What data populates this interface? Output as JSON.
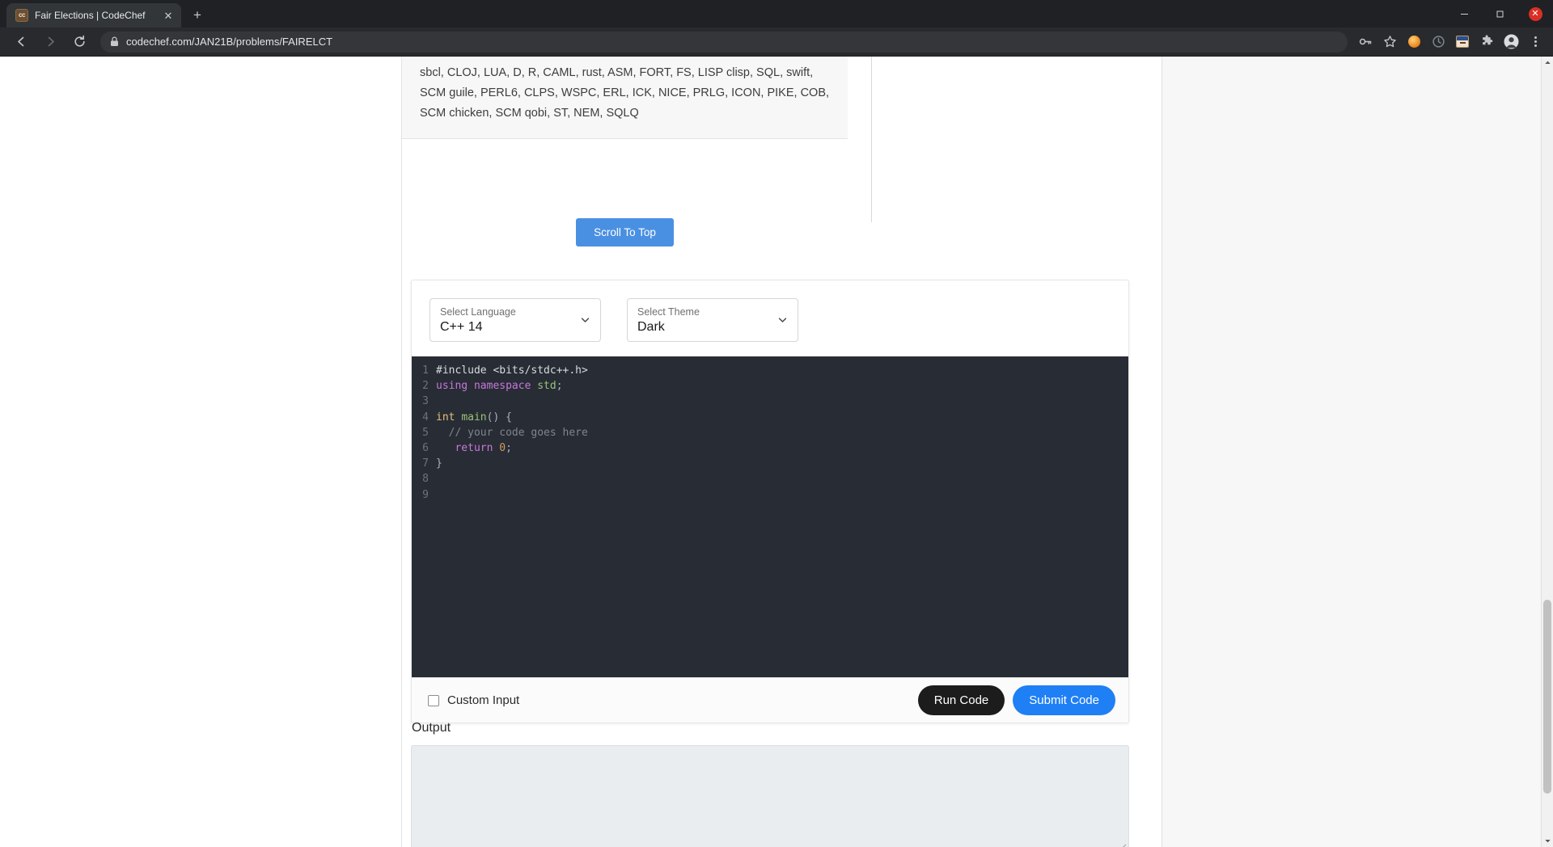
{
  "browser": {
    "tab": {
      "title": "Fair Elections | CodeChef",
      "favicon_text": "cc",
      "favicon_name": "codechef-favicon",
      "close_label": "✕"
    },
    "new_tab_label": "+",
    "window_controls": {
      "minimize": "minimize-icon",
      "maximize": "maximize-icon",
      "close": "✕"
    },
    "toolbar": {
      "back": "back-arrow-icon",
      "forward": "forward-arrow-icon",
      "reload": "reload-icon",
      "url": "codechef.com/JAN21B/problems/FAIRELCT",
      "lock": "lock-icon",
      "icons": [
        "password-key-icon",
        "bookmark-star-icon",
        "extension-orange-icon",
        "extension-clock-icon",
        "extension-avatar-icon",
        "puzzle-extensions-icon",
        "profile-avatar-icon",
        "three-dot-menu-icon"
      ]
    }
  },
  "page": {
    "languages_paragraph": [
      "sbcl, CLOJ, LUA, D, R, CAML, rust, ASM, FORT, FS, LISP",
      "clisp, SQL, swift, SCM guile, PERL6, CLPS, WSPC, ERL, ICK,",
      "NICE, PRLG, ICON, PIKE, COB, SCM chicken, SCM qobi, ST,",
      "NEM, SQLQ"
    ],
    "scroll_to_top_label": "Scroll To Top",
    "ide": {
      "language_select": {
        "label": "Select Language",
        "value": "C++ 14",
        "chevron": "chevron-down-icon"
      },
      "theme_select": {
        "label": "Select Theme",
        "value": "Dark",
        "chevron": "chevron-down-icon"
      },
      "code_lines": [
        {
          "n": "1",
          "tokens": [
            {
              "t": "#include <bits/stdc++.h>",
              "c": "tk-inc"
            }
          ]
        },
        {
          "n": "2",
          "tokens": [
            {
              "t": "using namespace ",
              "c": "tk-kw"
            },
            {
              "t": "std",
              "c": "tk-ns"
            },
            {
              "t": ";",
              "c": "tk-pun"
            }
          ]
        },
        {
          "n": "3",
          "tokens": [
            {
              "t": "",
              "c": "tk-inc"
            }
          ]
        },
        {
          "n": "4",
          "tokens": [
            {
              "t": "int ",
              "c": "tk-type"
            },
            {
              "t": "main",
              "c": "tk-ns"
            },
            {
              "t": "() {",
              "c": "tk-pun"
            }
          ]
        },
        {
          "n": "5",
          "tokens": [
            {
              "t": "  // your code goes here",
              "c": "tk-cm"
            }
          ]
        },
        {
          "n": "6",
          "tokens": [
            {
              "t": "   return ",
              "c": "tk-kw"
            },
            {
              "t": "0",
              "c": "tk-num"
            },
            {
              "t": ";",
              "c": "tk-pun"
            }
          ]
        },
        {
          "n": "7",
          "tokens": [
            {
              "t": "}",
              "c": "tk-pun"
            }
          ]
        },
        {
          "n": "8",
          "tokens": [
            {
              "t": "",
              "c": "tk-inc"
            }
          ]
        },
        {
          "n": "9",
          "tokens": [
            {
              "t": "",
              "c": "tk-inc"
            }
          ]
        }
      ],
      "custom_input_label": "Custom Input",
      "custom_input_checked": false,
      "run_label": "Run Code",
      "submit_label": "Submit Code"
    },
    "output": {
      "label": "Output",
      "value": ""
    }
  },
  "colors": {
    "accent_blue": "#1f7ff5",
    "scroll_button_blue": "#4a90e2",
    "run_black": "#1c1c1c",
    "editor_bg": "#282c34",
    "output_bg": "#e9edf0"
  }
}
